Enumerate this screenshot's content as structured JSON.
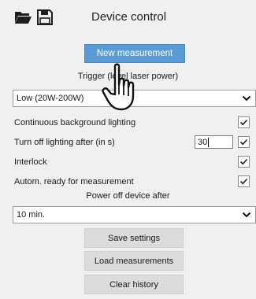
{
  "header": {
    "title": "Device control",
    "icons": [
      "folder-open-icon",
      "save-disk-icon"
    ]
  },
  "new_measurement_label": "New measurement",
  "trigger": {
    "label": "Trigger (level laser power)",
    "selected": "Low (20W-200W)"
  },
  "settings": {
    "continuous_lighting": {
      "label": "Continuous background lighting",
      "checked": true
    },
    "turn_off_lighting": {
      "label": "Turn off lighting after (in s)",
      "value": "30",
      "checked": true
    },
    "interlock": {
      "label": "Interlock",
      "checked": true
    },
    "auto_ready": {
      "label": "Autom. ready for measurement",
      "checked": true
    }
  },
  "power_off": {
    "label": "Power off device after",
    "selected": "10 min."
  },
  "buttons": {
    "save_settings": "Save settings",
    "load_measurements": "Load measurements",
    "clear_history": "Clear history"
  },
  "cursor": "hand-pointer-icon"
}
